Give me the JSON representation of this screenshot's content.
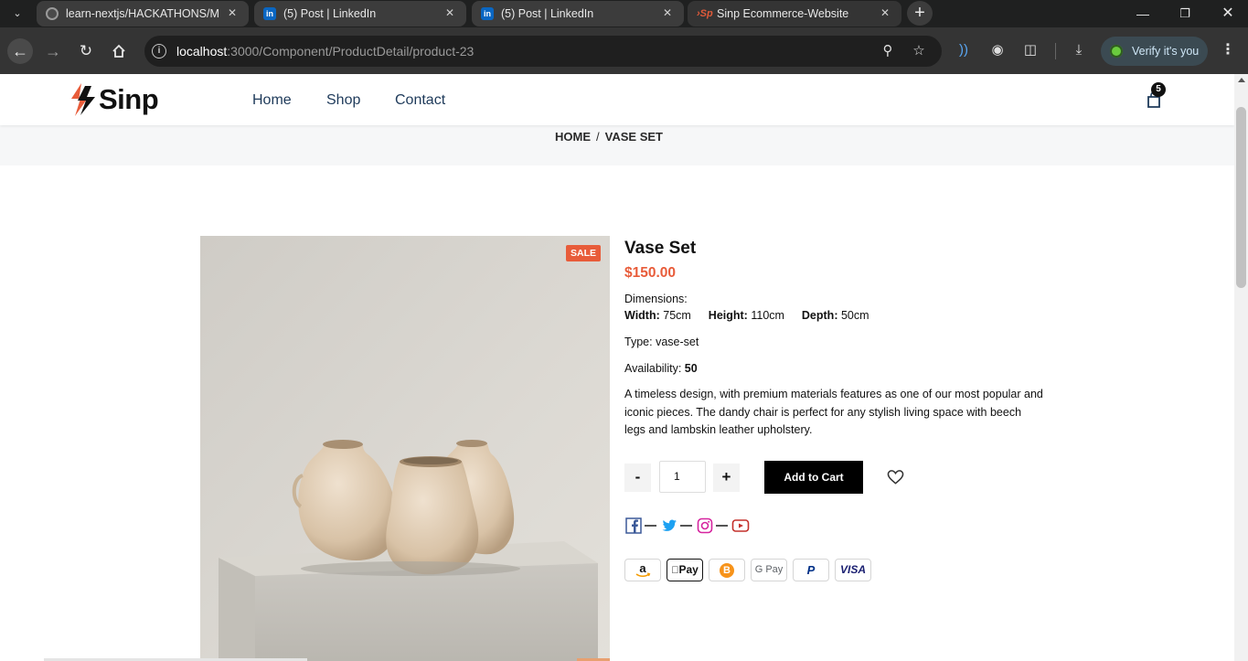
{
  "browser": {
    "tabs": [
      {
        "title": "learn-nextjs/HACKATHONS/Ma",
        "favicon": "github-icon"
      },
      {
        "title": "(5) Post | LinkedIn",
        "favicon": "linkedin-icon"
      },
      {
        "title": "(5) Post | LinkedIn",
        "favicon": "linkedin-icon"
      },
      {
        "title": "Sinp Ecommerce-Website",
        "favicon": "sinp-icon",
        "active": true
      }
    ],
    "url_host": "localhost",
    "url_path": ":3000/Component/ProductDetail/product-23",
    "verify_label": "Verify it's you"
  },
  "site": {
    "logo_text": "Sinp",
    "nav": [
      "Home",
      "Shop",
      "Contact"
    ],
    "cart_count": "5",
    "accent_color": "#e85c3a"
  },
  "breadcrumb": {
    "home": "HOME",
    "sep": "/",
    "current": "VASE SET"
  },
  "product": {
    "sale_badge": "SALE",
    "name": "Vase Set",
    "price": "$150.00",
    "dimensions_label": "Dimensions:",
    "width_label": "Width:",
    "width_value": "75cm",
    "height_label": "Height:",
    "height_value": "110cm",
    "depth_label": "Depth:",
    "depth_value": "50cm",
    "type_label": "Type:",
    "type_value": "vase-set",
    "availability_label": "Availability:",
    "availability_value": "50",
    "description": "A timeless design, with premium materials features as one of our most popular and iconic pieces. The dandy chair is perfect for any stylish living space with beech legs and lambskin leather upholstery.",
    "qty_minus": "-",
    "qty_value": "1",
    "qty_plus": "+",
    "add_to_cart": "Add to Cart"
  },
  "social": [
    "facebook-icon",
    "twitter-icon",
    "instagram-icon",
    "youtube-icon"
  ],
  "payments": [
    {
      "name": "amazon-pay-icon",
      "label": "a"
    },
    {
      "name": "apple-pay-icon",
      "label": "Pay"
    },
    {
      "name": "bitcoin-icon",
      "label": "B"
    },
    {
      "name": "google-pay-icon",
      "label": "G Pay"
    },
    {
      "name": "paypal-icon",
      "label": "P"
    },
    {
      "name": "visa-icon",
      "label": "VISA"
    }
  ]
}
